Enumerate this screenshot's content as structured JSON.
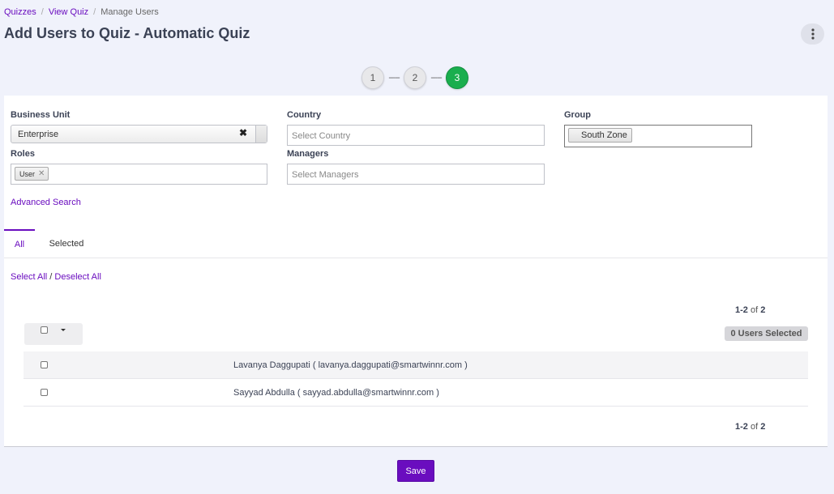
{
  "breadcrumb": {
    "item1": "Quizzes",
    "item2": "View Quiz",
    "current": "Manage Users",
    "sep": "/"
  },
  "page": {
    "title": "Add Users to Quiz - Automatic Quiz"
  },
  "stepper": {
    "step1": "1",
    "step2": "2",
    "step3": "3",
    "dash": "-----",
    "active_step": 3,
    "active_color": "#1aae4e"
  },
  "filters": {
    "business_unit": {
      "label": "Business Unit",
      "value": "Enterprise",
      "clear_glyph": "✖"
    },
    "country": {
      "label": "Country",
      "placeholder": "Select Country"
    },
    "group": {
      "label": "Group",
      "tag": "South Zone"
    },
    "roles": {
      "label": "Roles",
      "tag": "User",
      "tag_remove": "✕"
    },
    "managers": {
      "label": "Managers",
      "placeholder": "Select Managers"
    }
  },
  "advanced_search": "Advanced Search",
  "tabs": {
    "all": "All",
    "selected": "Selected"
  },
  "select_links": {
    "select_all": "Select All",
    "sep": " / ",
    "deselect_all": "Deselect All"
  },
  "pagination": {
    "range": "1-2",
    "of": "of",
    "total": "2"
  },
  "selection_badge": "0 Users Selected",
  "users": [
    {
      "label": "Lavanya Daggupati ( lavanya.daggupati@smartwinnr.com )"
    },
    {
      "label": "Sayyad Abdulla ( sayyad.abdulla@smartwinnr.com )"
    }
  ],
  "save_label": "Save",
  "accent_color": "#6a0dbf"
}
